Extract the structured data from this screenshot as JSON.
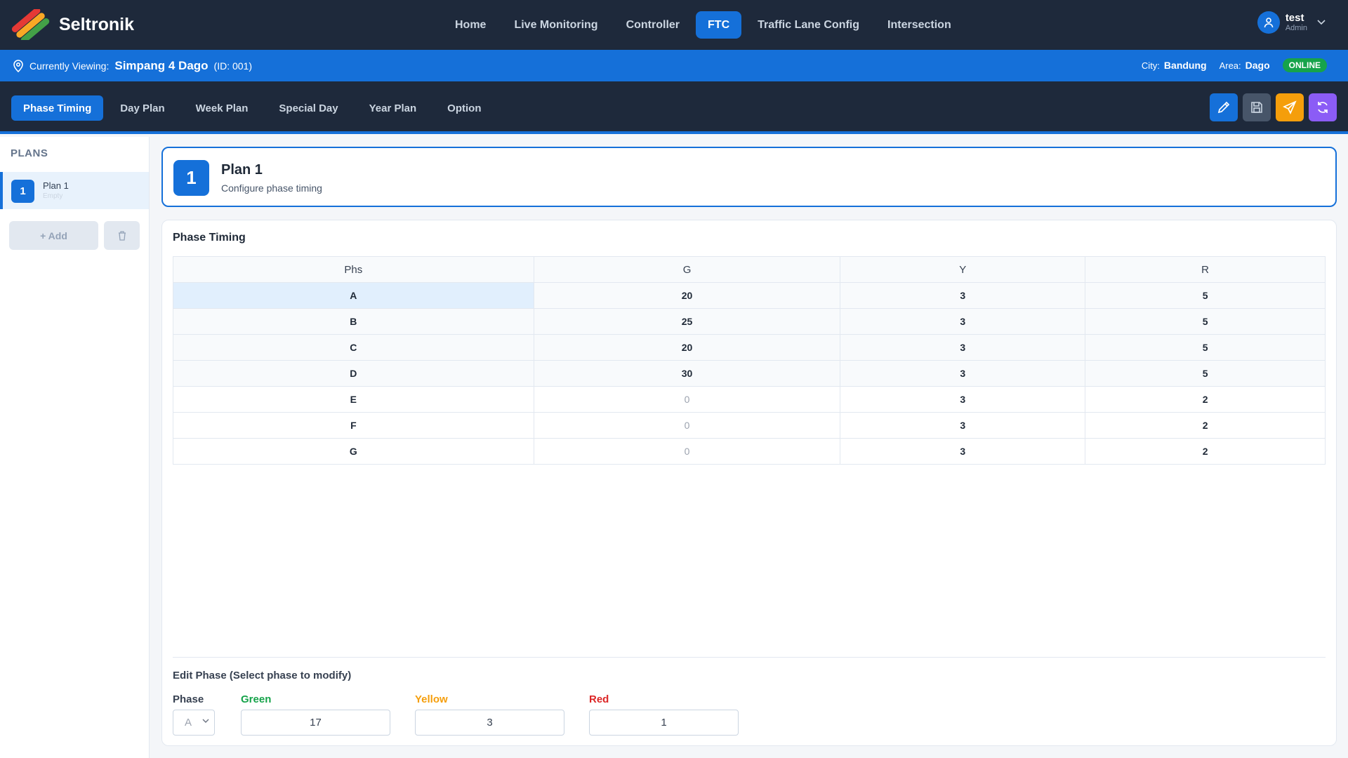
{
  "app": {
    "name": "Seltronik"
  },
  "nav": {
    "items": [
      "Home",
      "Live Monitoring",
      "Controller",
      "FTC",
      "Traffic Lane Config",
      "Intersection"
    ],
    "active": "FTC"
  },
  "user": {
    "name": "test",
    "role": "Admin"
  },
  "info": {
    "viewing_label": "Currently Viewing:",
    "location": "Simpang 4 Dago",
    "id": "(ID: 001)",
    "city_label": "City:",
    "city": "Bandung",
    "area_label": "Area:",
    "area": "Dago",
    "status": "ONLINE"
  },
  "subtabs": {
    "items": [
      "Phase Timing",
      "Day Plan",
      "Week Plan",
      "Special Day",
      "Year Plan",
      "Option"
    ],
    "active": "Phase Timing"
  },
  "actions": [
    {
      "icon": "pencil-icon",
      "color": "#1570d9"
    },
    {
      "icon": "save-icon",
      "color": "#475569"
    },
    {
      "icon": "send-icon",
      "color": "#f59e0b"
    },
    {
      "icon": "refresh-icon",
      "color": "#8b5cf6"
    }
  ],
  "sidebar": {
    "title": "PLANS",
    "plans": [
      {
        "number": "1",
        "name": "Plan 1",
        "status": "Empty"
      }
    ],
    "add_label": "+ Add"
  },
  "plan_card": {
    "number": "1",
    "title": "Plan 1",
    "subtitle": "Configure phase timing"
  },
  "phase_timing": {
    "title": "Phase Timing",
    "columns": [
      "Phs",
      "G",
      "Y",
      "R"
    ],
    "rows": [
      {
        "phs": "A",
        "g": "20",
        "y": "3",
        "r": "5"
      },
      {
        "phs": "B",
        "g": "25",
        "y": "3",
        "r": "5"
      },
      {
        "phs": "C",
        "g": "20",
        "y": "3",
        "r": "5"
      },
      {
        "phs": "D",
        "g": "30",
        "y": "3",
        "r": "5"
      },
      {
        "phs": "E",
        "g": "0",
        "y": "3",
        "r": "2"
      },
      {
        "phs": "F",
        "g": "0",
        "y": "3",
        "r": "2"
      },
      {
        "phs": "G",
        "g": "0",
        "y": "3",
        "r": "2"
      }
    ]
  },
  "edit": {
    "title": "Edit Phase (Select phase to modify)",
    "phase_label": "Phase",
    "phase_value": "A",
    "green_label": "Green",
    "green_value": "17",
    "yellow_label": "Yellow",
    "yellow_value": "3",
    "red_label": "Red",
    "red_value": "1",
    "colors": {
      "green": "#16a34a",
      "yellow": "#f59e0b",
      "red": "#dc2626"
    }
  }
}
